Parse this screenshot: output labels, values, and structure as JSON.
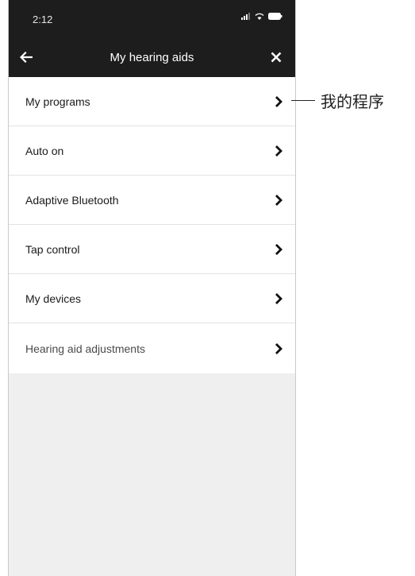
{
  "status_bar": {
    "time": "2:12"
  },
  "header": {
    "title": "My hearing aids",
    "back_icon": "arrow-left-icon",
    "close_icon": "close-icon"
  },
  "menu": {
    "items": [
      {
        "label": "My programs"
      },
      {
        "label": "Auto on"
      },
      {
        "label": "Adaptive Bluetooth"
      },
      {
        "label": "Tap control"
      },
      {
        "label": "My devices"
      },
      {
        "label": "Hearing aid adjustments"
      }
    ]
  },
  "annotation": {
    "callout_text": "我的程序"
  },
  "colors": {
    "header_bg": "#1d1d1d",
    "list_bg": "#ffffff",
    "page_bg": "#efefef"
  }
}
